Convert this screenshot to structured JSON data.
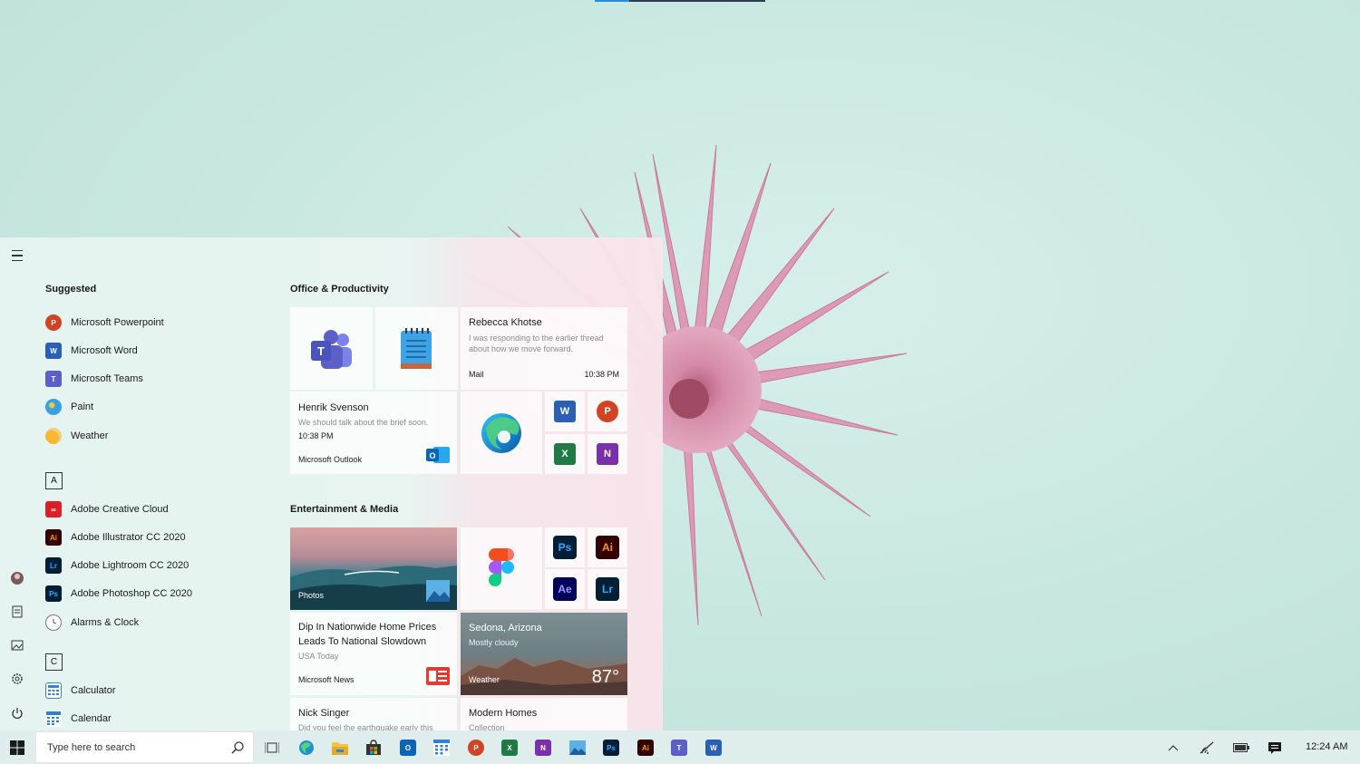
{
  "start_menu": {
    "suggested_title": "Suggested",
    "suggested": [
      {
        "label": "Microsoft Powerpoint",
        "icon": "powerpoint-icon",
        "color": "#d04423",
        "glyph": "P"
      },
      {
        "label": "Microsoft Word",
        "icon": "word-icon",
        "color": "#2b5fb4",
        "glyph": "W"
      },
      {
        "label": "Microsoft Teams",
        "icon": "teams-icon",
        "color": "#5b5fc7",
        "glyph": "T"
      },
      {
        "label": "Paint",
        "icon": "paint-icon",
        "color": "#3aa0e0",
        "glyph": ""
      },
      {
        "label": "Weather",
        "icon": "weather-icon",
        "color": "#f2a81d",
        "glyph": ""
      }
    ],
    "letter_a": "A",
    "a_apps": [
      {
        "label": "Adobe Creative Cloud",
        "icon": "creative-cloud-icon",
        "color": "#da1f26",
        "glyph": "Cc"
      },
      {
        "label": "Adobe Illustrator CC 2020",
        "icon": "illustrator-icon",
        "color": "#330000",
        "glyph": "Ai"
      },
      {
        "label": "Adobe Lightroom CC 2020",
        "icon": "lightroom-icon",
        "color": "#001e36",
        "glyph": "Lr"
      },
      {
        "label": "Adobe Photoshop CC 2020",
        "icon": "photoshop-icon",
        "color": "#001e36",
        "glyph": "Ps"
      },
      {
        "label": "Alarms & Clock",
        "icon": "alarms-clock-icon",
        "color": "#8a8a8a",
        "glyph": ""
      }
    ],
    "letter_c": "C",
    "c_apps": [
      {
        "label": "Calculator",
        "icon": "calculator-icon",
        "color": "#3b7fd6",
        "glyph": ""
      },
      {
        "label": "Calendar",
        "icon": "calendar-icon",
        "color": "#2f7fd8",
        "glyph": ""
      }
    ],
    "office_group": "Office & Productivity",
    "entertainment_group": "Entertainment & Media",
    "mail_tile": {
      "sender": "Rebecca Khotse",
      "preview": "I was responding to the earlier thread about how we move forward.",
      "app": "Mail",
      "time": "10:38 PM"
    },
    "outlook_tile": {
      "sender": "Henrik Svenson",
      "preview": "We should talk about the brief soon.",
      "time": "10:38 PM",
      "app": "Microsoft Outlook"
    },
    "photos_tile": {
      "label": "Photos"
    },
    "news_tile": {
      "headline_1": "Dip In Nationwide Home Prices",
      "headline_2": "Leads To National Slowdown",
      "source": "USA Today",
      "app": "Microsoft News"
    },
    "weather_tile": {
      "location": "Sedona, Arizona",
      "condition": "Mostly cloudy",
      "app": "Weather",
      "temperature": "87°"
    },
    "nick_tile": {
      "sender": "Nick Singer",
      "preview": "Did you feel the earthquake early this"
    },
    "homes_tile": {
      "title": "Modern Homes",
      "sub": "Collection"
    },
    "adobe_tiles": {
      "ps": "Ps",
      "ai": "Ai",
      "ae": "Ae",
      "lr": "Lr"
    },
    "office_minis": {
      "word": "W",
      "ppt": "P",
      "excel": "X",
      "onenote": "N"
    }
  },
  "taskbar": {
    "search_placeholder": "Type here to search",
    "time": "12:24 AM"
  },
  "colors": {
    "accent": "#2a8bd6",
    "teams": "#5b5fc7",
    "word": "#2b5fb4",
    "powerpoint": "#d04423",
    "excel": "#1f7a45",
    "onenote": "#7b2fa8"
  }
}
